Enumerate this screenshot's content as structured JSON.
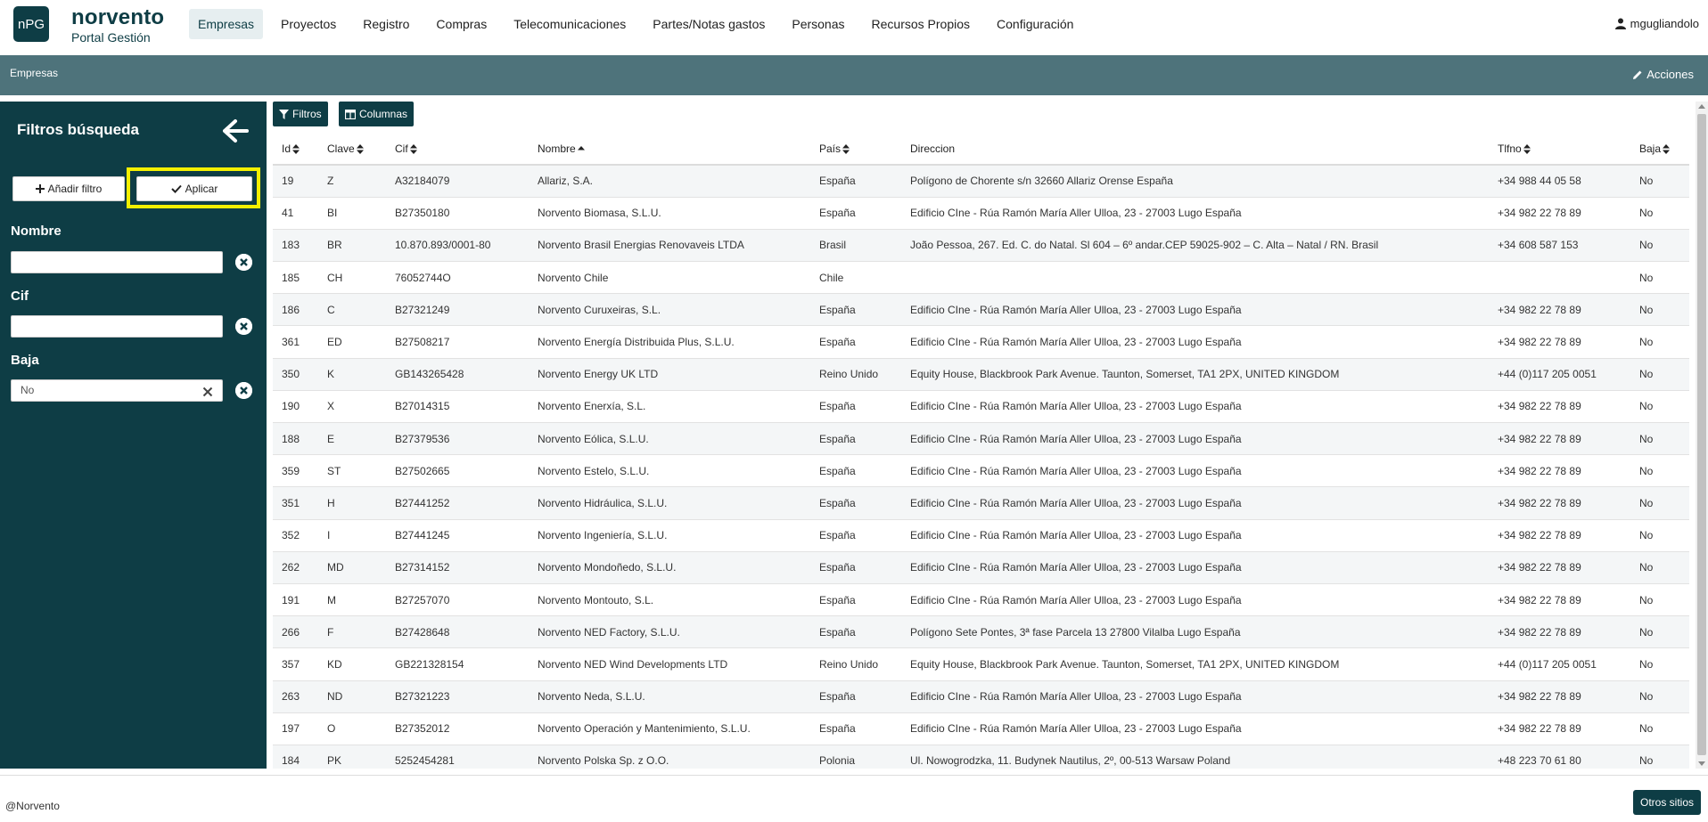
{
  "header": {
    "logo": "nPG",
    "brand_name": "norvento",
    "brand_sub": "Portal Gestión",
    "nav": [
      "Empresas",
      "Proyectos",
      "Registro",
      "Compras",
      "Telecomunicaciones",
      "Partes/Notas gastos",
      "Personas",
      "Recursos Propios",
      "Configuración"
    ],
    "active_nav": "Empresas",
    "user": "mgugliandolo"
  },
  "titlebar": {
    "title": "Empresas",
    "actions": "Acciones"
  },
  "sidebar": {
    "title": "Filtros búsqueda",
    "add_filter": "Añadir filtro",
    "apply": "Aplicar",
    "filters": [
      {
        "label": "Nombre",
        "value": ""
      },
      {
        "label": "Cif",
        "value": ""
      },
      {
        "label": "Baja",
        "value": "No"
      }
    ]
  },
  "toolbar": {
    "filters": "Filtros",
    "columns": "Columnas"
  },
  "table": {
    "columns": [
      "Id",
      "Clave",
      "Cif",
      "Nombre",
      "País",
      "Direccion",
      "Tlfno",
      "Baja"
    ],
    "rows": [
      [
        "19",
        "Z",
        "A32184079",
        "Allariz, S.A.",
        "España",
        "Polígono de Chorente s/n 32660 Allariz Orense España",
        "+34 988 44 05 58",
        "No"
      ],
      [
        "41",
        "BI",
        "B27350180",
        "Norvento Biomasa, S.L.U.",
        "España",
        "Edificio CIne - Rúa Ramón María Aller Ulloa, 23 - 27003 Lugo España",
        "+34 982 22 78 89",
        "No"
      ],
      [
        "183",
        "BR",
        "10.870.893/0001-80",
        "Norvento Brasil Energias Renovaveis LTDA",
        "Brasil",
        "João Pessoa, 267. Ed. C. do Natal. Sl 604 – 6º andar.CEP 59025-902 – C. Alta – Natal / RN. Brasil",
        "+34 608 587 153",
        "No"
      ],
      [
        "185",
        "CH",
        "76052744O",
        "Norvento Chile",
        "Chile",
        "",
        "",
        "No"
      ],
      [
        "186",
        "C",
        "B27321249",
        "Norvento Curuxeiras, S.L.",
        "España",
        "Edificio CIne - Rúa Ramón María Aller Ulloa, 23 - 27003 Lugo España",
        "+34 982 22 78 89",
        "No"
      ],
      [
        "361",
        "ED",
        "B27508217",
        "Norvento Energía Distribuida Plus, S.L.U.",
        "España",
        "Edificio CIne - Rúa Ramón María Aller Ulloa, 23 - 27003 Lugo España",
        "+34 982 22 78 89",
        "No"
      ],
      [
        "350",
        "K",
        "GB143265428",
        "Norvento Energy UK LTD",
        "Reino Unido",
        "Equity House, Blackbrook Park Avenue. Taunton, Somerset, TA1 2PX, UNITED KINGDOM",
        "+44 (0)117 205 0051",
        "No"
      ],
      [
        "190",
        "X",
        "B27014315",
        "Norvento Enerxía, S.L.",
        "España",
        "Edificio CIne - Rúa Ramón María Aller Ulloa, 23 - 27003 Lugo España",
        "+34 982 22 78 89",
        "No"
      ],
      [
        "188",
        "E",
        "B27379536",
        "Norvento Eólica, S.L.U.",
        "España",
        "Edificio CIne - Rúa Ramón María Aller Ulloa, 23 - 27003 Lugo España",
        "+34 982 22 78 89",
        "No"
      ],
      [
        "359",
        "ST",
        "B27502665",
        "Norvento Estelo, S.L.U.",
        "España",
        "Edificio CIne - Rúa Ramón María Aller Ulloa, 23 - 27003 Lugo España",
        "+34 982 22 78 89",
        "No"
      ],
      [
        "351",
        "H",
        "B27441252",
        "Norvento Hidráulica, S.L.U.",
        "España",
        "Edificio CIne - Rúa Ramón María Aller Ulloa, 23 - 27003 Lugo España",
        "+34 982 22 78 89",
        "No"
      ],
      [
        "352",
        "I",
        "B27441245",
        "Norvento Ingeniería, S.L.U.",
        "España",
        "Edificio CIne - Rúa Ramón María Aller Ulloa, 23 - 27003 Lugo España",
        "+34 982 22 78 89",
        "No"
      ],
      [
        "262",
        "MD",
        "B27314152",
        "Norvento Mondoñedo, S.L.U.",
        "España",
        "Edificio CIne - Rúa Ramón María Aller Ulloa, 23 - 27003 Lugo España",
        "+34 982 22 78 89",
        "No"
      ],
      [
        "191",
        "M",
        "B27257070",
        "Norvento Montouto, S.L.",
        "España",
        "Edificio CIne - Rúa Ramón María Aller Ulloa, 23 - 27003 Lugo España",
        "+34 982 22 78 89",
        "No"
      ],
      [
        "266",
        "F",
        "B27428648",
        "Norvento NED Factory, S.L.U.",
        "España",
        "Polígono Sete Pontes, 3ª fase Parcela 13 27800 Vilalba Lugo España",
        "+34 982 22 78 89",
        "No"
      ],
      [
        "357",
        "KD",
        "GB221328154",
        "Norvento NED Wind Developments LTD",
        "Reino Unido",
        "Equity House, Blackbrook Park Avenue. Taunton, Somerset, TA1 2PX, UNITED KINGDOM",
        "+44 (0)117 205 0051",
        "No"
      ],
      [
        "263",
        "ND",
        "B27321223",
        "Norvento Neda, S.L.U.",
        "España",
        "Edificio CIne - Rúa Ramón María Aller Ulloa, 23 - 27003 Lugo España",
        "+34 982 22 78 89",
        "No"
      ],
      [
        "197",
        "O",
        "B27352012",
        "Norvento Operación y Mantenimiento, S.L.U.",
        "España",
        "Edificio CIne - Rúa Ramón María Aller Ulloa, 23 - 27003 Lugo España",
        "+34 982 22 78 89",
        "No"
      ],
      [
        "184",
        "PK",
        "5252454281",
        "Norvento Polska Sp. z O.O.",
        "Polonia",
        "Ul. Nowogrodzka, 11. Budynek Nautilus, 2º, 00-513 Warsaw Poland",
        "+48 223 70 61 80",
        "No"
      ]
    ]
  },
  "footer": {
    "copyright": "@Norvento",
    "other_sites": "Otros sitios"
  },
  "colors": {
    "primary": "#0e3d45",
    "titlebar": "#4e737b",
    "highlight": "#f4f000"
  }
}
